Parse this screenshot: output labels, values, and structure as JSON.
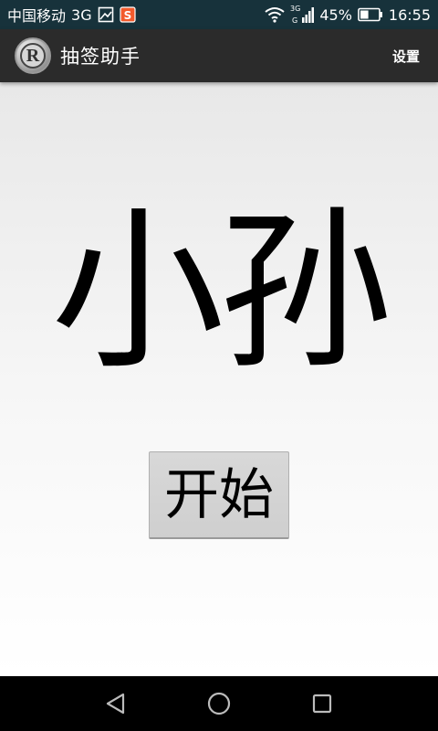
{
  "status_bar": {
    "carrier": "中国移动",
    "network": "3G",
    "battery_percent": "45%",
    "time": "16:55",
    "battery_level": 0.45,
    "icons": [
      "image-icon",
      "s-app-icon",
      "wifi-icon",
      "signal-3g-icon",
      "battery-icon"
    ]
  },
  "action_bar": {
    "title": "抽签助手",
    "settings_label": "设置",
    "app_icon_letter": "R"
  },
  "main": {
    "result_name": "小孙",
    "start_button_label": "开始"
  },
  "nav_bar": {
    "icons": [
      "back-icon",
      "home-icon",
      "recents-icon"
    ]
  },
  "colors": {
    "status_bar_bg": "#17323b",
    "action_bar_bg": "#2b2b2b",
    "content_bg_top": "#e8e8e8",
    "content_bg_bottom": "#ffffff",
    "button_bg": "#d4d4d4"
  }
}
